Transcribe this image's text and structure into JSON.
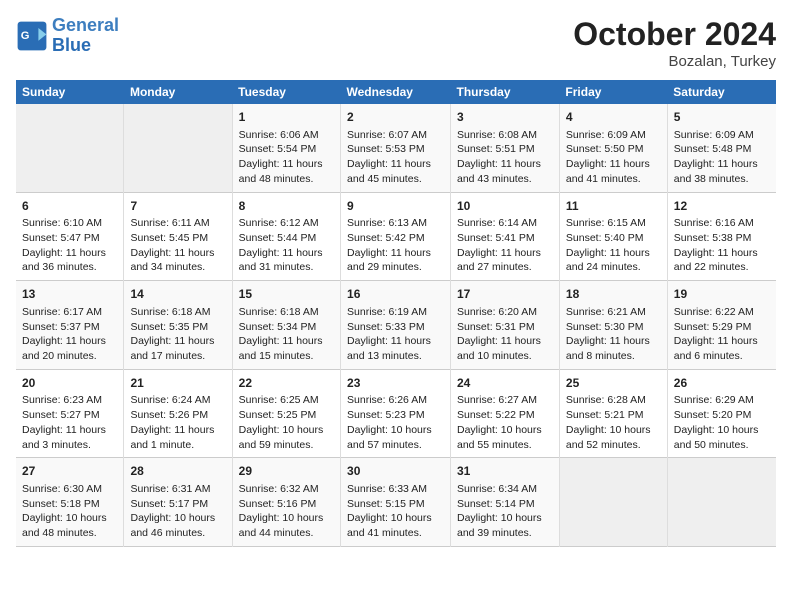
{
  "logo": {
    "text_general": "General",
    "text_blue": "Blue"
  },
  "title": "October 2024",
  "location": "Bozalan, Turkey",
  "days_header": [
    "Sunday",
    "Monday",
    "Tuesday",
    "Wednesday",
    "Thursday",
    "Friday",
    "Saturday"
  ],
  "weeks": [
    [
      {
        "day": "",
        "empty": true
      },
      {
        "day": "",
        "empty": true
      },
      {
        "day": "1",
        "sunrise": "Sunrise: 6:06 AM",
        "sunset": "Sunset: 5:54 PM",
        "daylight": "Daylight: 11 hours and 48 minutes."
      },
      {
        "day": "2",
        "sunrise": "Sunrise: 6:07 AM",
        "sunset": "Sunset: 5:53 PM",
        "daylight": "Daylight: 11 hours and 45 minutes."
      },
      {
        "day": "3",
        "sunrise": "Sunrise: 6:08 AM",
        "sunset": "Sunset: 5:51 PM",
        "daylight": "Daylight: 11 hours and 43 minutes."
      },
      {
        "day": "4",
        "sunrise": "Sunrise: 6:09 AM",
        "sunset": "Sunset: 5:50 PM",
        "daylight": "Daylight: 11 hours and 41 minutes."
      },
      {
        "day": "5",
        "sunrise": "Sunrise: 6:09 AM",
        "sunset": "Sunset: 5:48 PM",
        "daylight": "Daylight: 11 hours and 38 minutes."
      }
    ],
    [
      {
        "day": "6",
        "sunrise": "Sunrise: 6:10 AM",
        "sunset": "Sunset: 5:47 PM",
        "daylight": "Daylight: 11 hours and 36 minutes."
      },
      {
        "day": "7",
        "sunrise": "Sunrise: 6:11 AM",
        "sunset": "Sunset: 5:45 PM",
        "daylight": "Daylight: 11 hours and 34 minutes."
      },
      {
        "day": "8",
        "sunrise": "Sunrise: 6:12 AM",
        "sunset": "Sunset: 5:44 PM",
        "daylight": "Daylight: 11 hours and 31 minutes."
      },
      {
        "day": "9",
        "sunrise": "Sunrise: 6:13 AM",
        "sunset": "Sunset: 5:42 PM",
        "daylight": "Daylight: 11 hours and 29 minutes."
      },
      {
        "day": "10",
        "sunrise": "Sunrise: 6:14 AM",
        "sunset": "Sunset: 5:41 PM",
        "daylight": "Daylight: 11 hours and 27 minutes."
      },
      {
        "day": "11",
        "sunrise": "Sunrise: 6:15 AM",
        "sunset": "Sunset: 5:40 PM",
        "daylight": "Daylight: 11 hours and 24 minutes."
      },
      {
        "day": "12",
        "sunrise": "Sunrise: 6:16 AM",
        "sunset": "Sunset: 5:38 PM",
        "daylight": "Daylight: 11 hours and 22 minutes."
      }
    ],
    [
      {
        "day": "13",
        "sunrise": "Sunrise: 6:17 AM",
        "sunset": "Sunset: 5:37 PM",
        "daylight": "Daylight: 11 hours and 20 minutes."
      },
      {
        "day": "14",
        "sunrise": "Sunrise: 6:18 AM",
        "sunset": "Sunset: 5:35 PM",
        "daylight": "Daylight: 11 hours and 17 minutes."
      },
      {
        "day": "15",
        "sunrise": "Sunrise: 6:18 AM",
        "sunset": "Sunset: 5:34 PM",
        "daylight": "Daylight: 11 hours and 15 minutes."
      },
      {
        "day": "16",
        "sunrise": "Sunrise: 6:19 AM",
        "sunset": "Sunset: 5:33 PM",
        "daylight": "Daylight: 11 hours and 13 minutes."
      },
      {
        "day": "17",
        "sunrise": "Sunrise: 6:20 AM",
        "sunset": "Sunset: 5:31 PM",
        "daylight": "Daylight: 11 hours and 10 minutes."
      },
      {
        "day": "18",
        "sunrise": "Sunrise: 6:21 AM",
        "sunset": "Sunset: 5:30 PM",
        "daylight": "Daylight: 11 hours and 8 minutes."
      },
      {
        "day": "19",
        "sunrise": "Sunrise: 6:22 AM",
        "sunset": "Sunset: 5:29 PM",
        "daylight": "Daylight: 11 hours and 6 minutes."
      }
    ],
    [
      {
        "day": "20",
        "sunrise": "Sunrise: 6:23 AM",
        "sunset": "Sunset: 5:27 PM",
        "daylight": "Daylight: 11 hours and 3 minutes."
      },
      {
        "day": "21",
        "sunrise": "Sunrise: 6:24 AM",
        "sunset": "Sunset: 5:26 PM",
        "daylight": "Daylight: 11 hours and 1 minute."
      },
      {
        "day": "22",
        "sunrise": "Sunrise: 6:25 AM",
        "sunset": "Sunset: 5:25 PM",
        "daylight": "Daylight: 10 hours and 59 minutes."
      },
      {
        "day": "23",
        "sunrise": "Sunrise: 6:26 AM",
        "sunset": "Sunset: 5:23 PM",
        "daylight": "Daylight: 10 hours and 57 minutes."
      },
      {
        "day": "24",
        "sunrise": "Sunrise: 6:27 AM",
        "sunset": "Sunset: 5:22 PM",
        "daylight": "Daylight: 10 hours and 55 minutes."
      },
      {
        "day": "25",
        "sunrise": "Sunrise: 6:28 AM",
        "sunset": "Sunset: 5:21 PM",
        "daylight": "Daylight: 10 hours and 52 minutes."
      },
      {
        "day": "26",
        "sunrise": "Sunrise: 6:29 AM",
        "sunset": "Sunset: 5:20 PM",
        "daylight": "Daylight: 10 hours and 50 minutes."
      }
    ],
    [
      {
        "day": "27",
        "sunrise": "Sunrise: 6:30 AM",
        "sunset": "Sunset: 5:18 PM",
        "daylight": "Daylight: 10 hours and 48 minutes."
      },
      {
        "day": "28",
        "sunrise": "Sunrise: 6:31 AM",
        "sunset": "Sunset: 5:17 PM",
        "daylight": "Daylight: 10 hours and 46 minutes."
      },
      {
        "day": "29",
        "sunrise": "Sunrise: 6:32 AM",
        "sunset": "Sunset: 5:16 PM",
        "daylight": "Daylight: 10 hours and 44 minutes."
      },
      {
        "day": "30",
        "sunrise": "Sunrise: 6:33 AM",
        "sunset": "Sunset: 5:15 PM",
        "daylight": "Daylight: 10 hours and 41 minutes."
      },
      {
        "day": "31",
        "sunrise": "Sunrise: 6:34 AM",
        "sunset": "Sunset: 5:14 PM",
        "daylight": "Daylight: 10 hours and 39 minutes."
      },
      {
        "day": "",
        "empty": true
      },
      {
        "day": "",
        "empty": true
      }
    ]
  ]
}
